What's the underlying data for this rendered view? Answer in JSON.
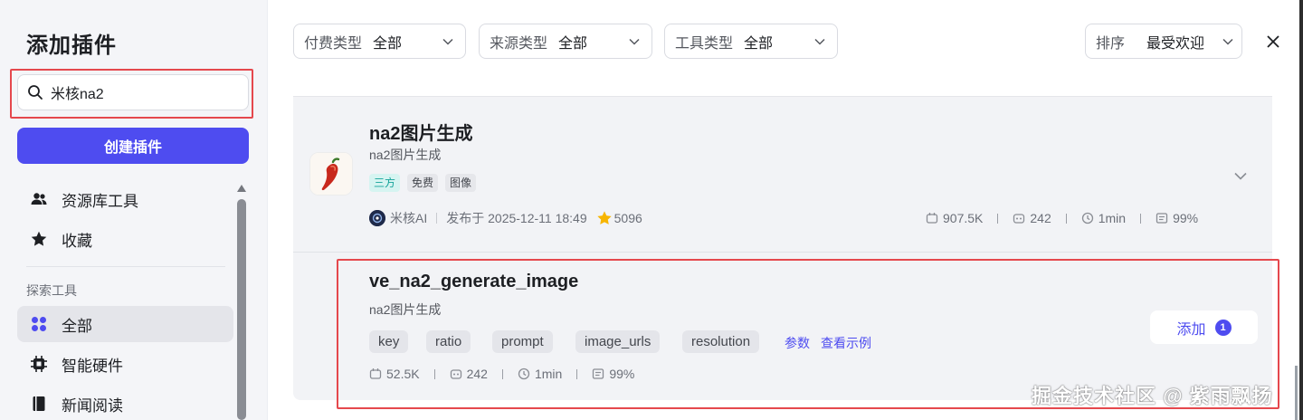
{
  "sidebar": {
    "title": "添加插件",
    "search": {
      "value": "米核na2",
      "placeholder": ""
    },
    "create_button": "创建插件",
    "nav_top": [
      {
        "label": "资源库工具",
        "icon": "users-icon"
      },
      {
        "label": "收藏",
        "icon": "star-icon"
      }
    ],
    "section_title": "探索工具",
    "nav_explore": [
      {
        "label": "全部",
        "icon": "grid-icon",
        "active": true
      },
      {
        "label": "智能硬件",
        "icon": "chip-icon"
      },
      {
        "label": "新闻阅读",
        "icon": "book-icon"
      }
    ]
  },
  "filters": [
    {
      "label": "付费类型",
      "value": "全部"
    },
    {
      "label": "来源类型",
      "value": "全部"
    },
    {
      "label": "工具类型",
      "value": "全部"
    }
  ],
  "sort": {
    "label": "排序",
    "value": "最受欢迎"
  },
  "plugin": {
    "name": "na2图片生成",
    "description": "na2图片生成",
    "tags": [
      "三方",
      "免费",
      "图像"
    ],
    "author": "米核AI",
    "published": "发布于 2025-12-11 18:49",
    "favorites": "5096",
    "stats": {
      "calls": "907.5K",
      "bots": "242",
      "latency": "1min",
      "success": "99%"
    }
  },
  "tool": {
    "name": "ve_na2_generate_image",
    "description": "na2图片生成",
    "params": [
      "key",
      "ratio",
      "prompt",
      "image_urls",
      "resolution"
    ],
    "params_link": "参数",
    "example_link": "查看示例",
    "stats": {
      "calls": "52.5K",
      "bots": "242",
      "latency": "1min",
      "success": "99%"
    },
    "add_label": "添加",
    "add_count": "1"
  },
  "watermark": "掘金技术社区 @ 紫雨飘扬",
  "colors": {
    "accent": "#4e4cf0",
    "highlight": "#e5484d",
    "tag_cyan": "#14a39a"
  }
}
